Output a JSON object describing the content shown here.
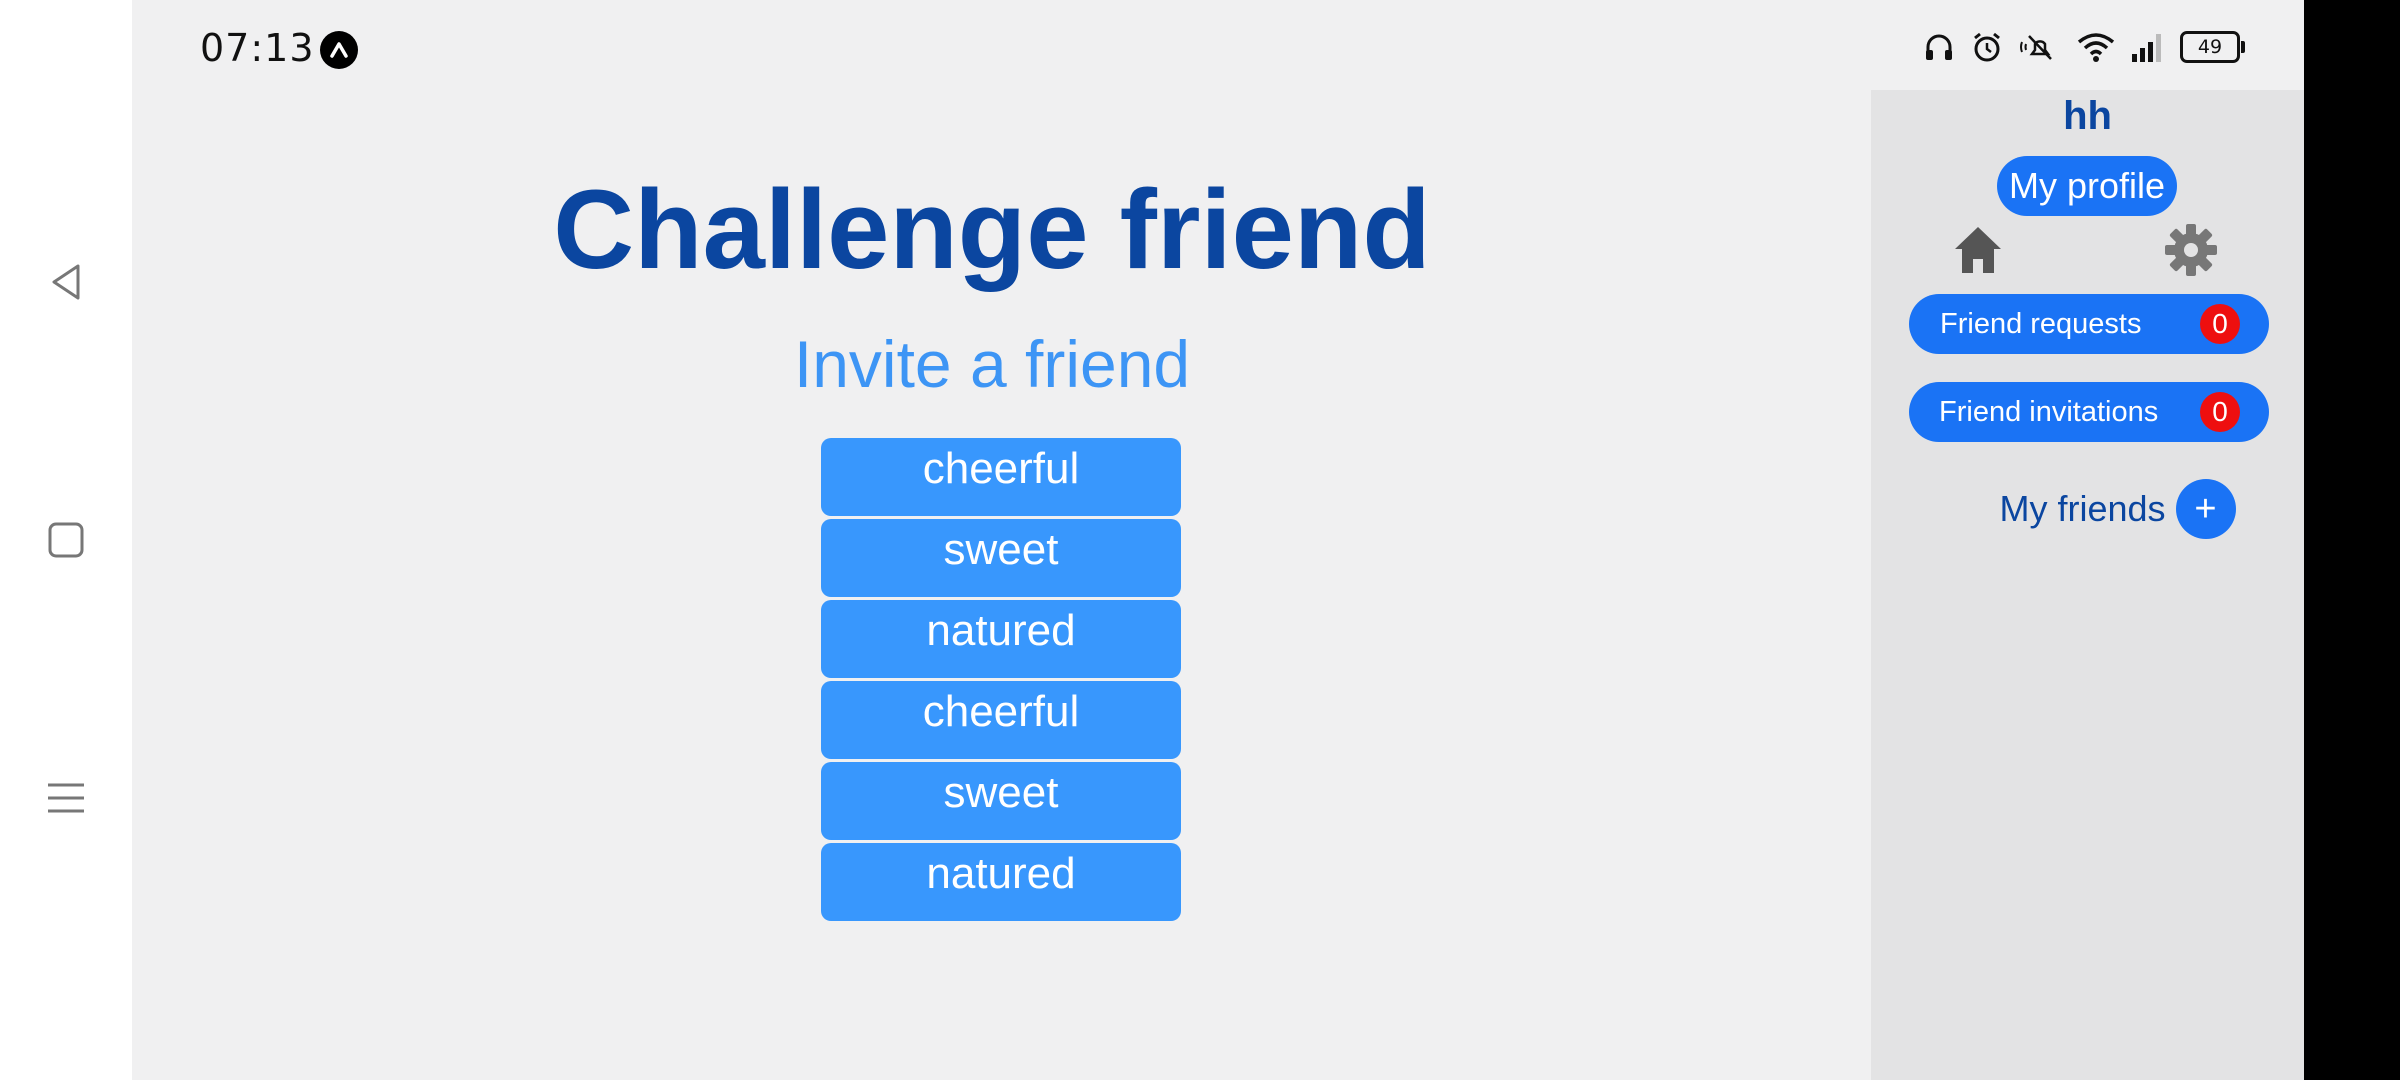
{
  "status_bar": {
    "time": "07:13",
    "battery": "49",
    "icons": [
      "notification-app-icon",
      "headphones-icon",
      "alarm-icon",
      "mute-icon",
      "wifi-icon",
      "signal-icon",
      "battery-icon"
    ]
  },
  "nav": {
    "back": "back-icon",
    "home": "square-home-icon",
    "menu": "menu-icon"
  },
  "main": {
    "title": "Challenge friend",
    "subtitle": "Invite a friend",
    "words": [
      "cheerful",
      "sweet",
      "natured",
      "cheerful",
      "sweet",
      "natured"
    ]
  },
  "sidebar": {
    "username": "hh",
    "profile_button": "My profile",
    "friend_requests": {
      "label": "Friend requests",
      "count": "0"
    },
    "friend_invitations": {
      "label": "Friend invitations",
      "count": "0"
    },
    "my_friends": "My friends",
    "add_symbol": "+"
  },
  "colors": {
    "title": "#0b46a0",
    "subtitle": "#3d95f5",
    "word_button": "#3897fd",
    "pill": "#1a73f5",
    "badge": "#ee0f0f",
    "sidebar_bg": "#e3e3e4",
    "screen_bg": "#f0f0f1"
  }
}
